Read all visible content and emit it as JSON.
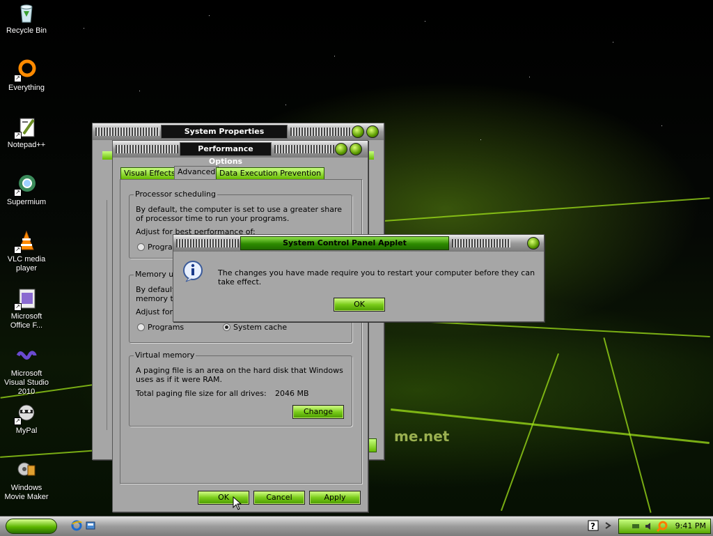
{
  "desktop": {
    "icons": [
      {
        "label": "Recycle Bin"
      },
      {
        "label": "Everything"
      },
      {
        "label": "Notepad++"
      },
      {
        "label": "Supermium"
      },
      {
        "label": "VLC media player"
      },
      {
        "label": "Microsoft Office F..."
      },
      {
        "label": "Microsoft Visual Studio 2010"
      },
      {
        "label": "MyPal"
      },
      {
        "label": "Windows Movie Maker"
      }
    ],
    "wallpaper_text": "me.net"
  },
  "system_properties": {
    "title": "System Properties"
  },
  "performance_options": {
    "title": "Performance Options",
    "tabs": [
      "Visual Effects",
      "Advanced",
      "Data Execution Prevention"
    ],
    "active_tab": "Advanced",
    "processor": {
      "heading": "Processor scheduling",
      "desc": "By default, the computer is set to use a greater share of processor time to run your programs.",
      "adjust": "Adjust for best performance of:",
      "option1": "Programs"
    },
    "memory": {
      "heading": "Memory usa",
      "desc": "By default,",
      "desc2": "memory to",
      "adjust": "Adjust for b",
      "option1": "Programs",
      "option2": "System cache",
      "selected": "System cache"
    },
    "virtual_memory": {
      "heading": "Virtual memory",
      "desc": "A paging file is an area on the hard disk that Windows uses as if it were RAM.",
      "total_label": "Total paging file size for all drives:",
      "total_value": "2046 MB",
      "change_label": "Change"
    },
    "ok_label": "OK",
    "cancel_label": "Cancel",
    "apply_label": "Apply"
  },
  "dialog": {
    "title": "System Control Panel Applet",
    "message": "The changes you have made require you to restart your computer before they can take effect.",
    "ok_label": "OK"
  },
  "taskbar": {
    "clock": "9:41 PM"
  },
  "colors": {
    "accent_green": "#66bb00",
    "window_gray": "#a6a6a6"
  }
}
